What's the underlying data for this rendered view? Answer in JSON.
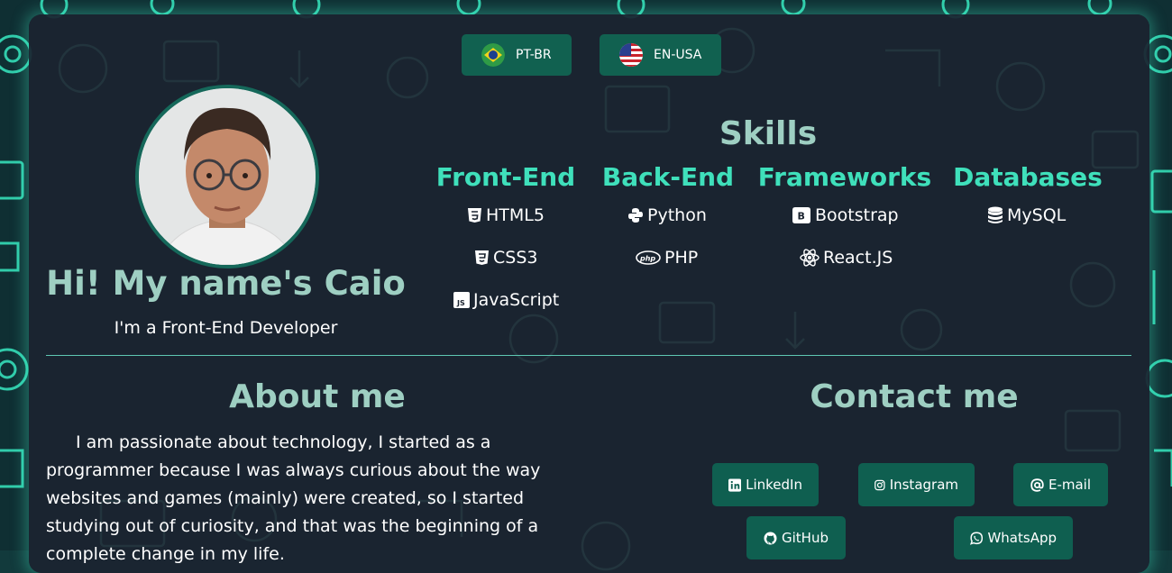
{
  "language_switcher": [
    {
      "label": "PT-BR",
      "flag": "brazil-flag-icon"
    },
    {
      "label": "EN-USA",
      "flag": "usa-flag-icon"
    }
  ],
  "profile": {
    "name": "Hi! My name's Caio",
    "role": "I'm a Front-End Developer"
  },
  "skills": {
    "title": "Skills",
    "categories": [
      {
        "name": "Front-End",
        "items": [
          {
            "label": "HTML5",
            "icon": "html5-icon"
          },
          {
            "label": "CSS3",
            "icon": "css3-icon"
          },
          {
            "label": "JavaScript",
            "icon": "javascript-icon"
          }
        ]
      },
      {
        "name": "Back-End",
        "items": [
          {
            "label": "Python",
            "icon": "python-icon"
          },
          {
            "label": "PHP",
            "icon": "php-icon"
          }
        ]
      },
      {
        "name": "Frameworks",
        "items": [
          {
            "label": "Bootstrap",
            "icon": "bootstrap-icon"
          },
          {
            "label": "React.JS",
            "icon": "react-icon"
          }
        ]
      },
      {
        "name": "Databases",
        "items": [
          {
            "label": "MySQL",
            "icon": "database-icon"
          }
        ]
      }
    ]
  },
  "about": {
    "title": "About me",
    "text": "I am passionate about technology, I started as a programmer because I was always curious about the way websites and games (mainly) were created, so I started studying out of curiosity, and that was the beginning of a complete change in my life."
  },
  "contact": {
    "title": "Contact me",
    "links": [
      {
        "label": "LinkedIn",
        "icon": "linkedin-icon"
      },
      {
        "label": "Instagram",
        "icon": "instagram-icon"
      },
      {
        "label": "E-mail",
        "icon": "at-sign-icon"
      },
      {
        "label": "GitHub",
        "icon": "github-icon"
      },
      {
        "label": "WhatsApp",
        "icon": "whatsapp-icon"
      }
    ]
  },
  "colors": {
    "accent": "#3fe0bb",
    "heading": "#9ecfc2",
    "button": "#116150",
    "card": "#1b2430"
  }
}
